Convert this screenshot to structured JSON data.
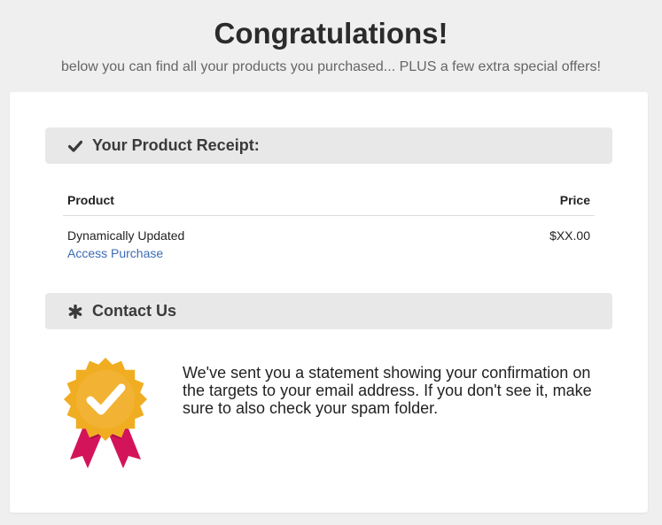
{
  "header": {
    "title": "Congratulations!",
    "subtitle": "below you can find all your products you purchased... PLUS a few extra special offers!"
  },
  "receipt": {
    "heading": "Your Product Receipt:",
    "icon": "checkmark-icon",
    "columns": {
      "product": "Product",
      "price": "Price"
    },
    "rows": [
      {
        "product": "Dynamically Updated",
        "link_label": "Access Purchase",
        "price": "$XX.00"
      }
    ]
  },
  "contact": {
    "heading": "Contact Us",
    "icon": "asterisk-icon",
    "badge_icon": "award-badge-icon",
    "message": "We've sent you a statement showing your confirmation on the targets to your email address. If you don't see it, make sure to also check your spam folder."
  },
  "colors": {
    "background": "#efefef",
    "card": "#ffffff",
    "section_bar": "#e8e8e8",
    "link": "#3c6bb3",
    "badge_gold": "#f0ad22",
    "badge_ribbon": "#d4145a"
  }
}
